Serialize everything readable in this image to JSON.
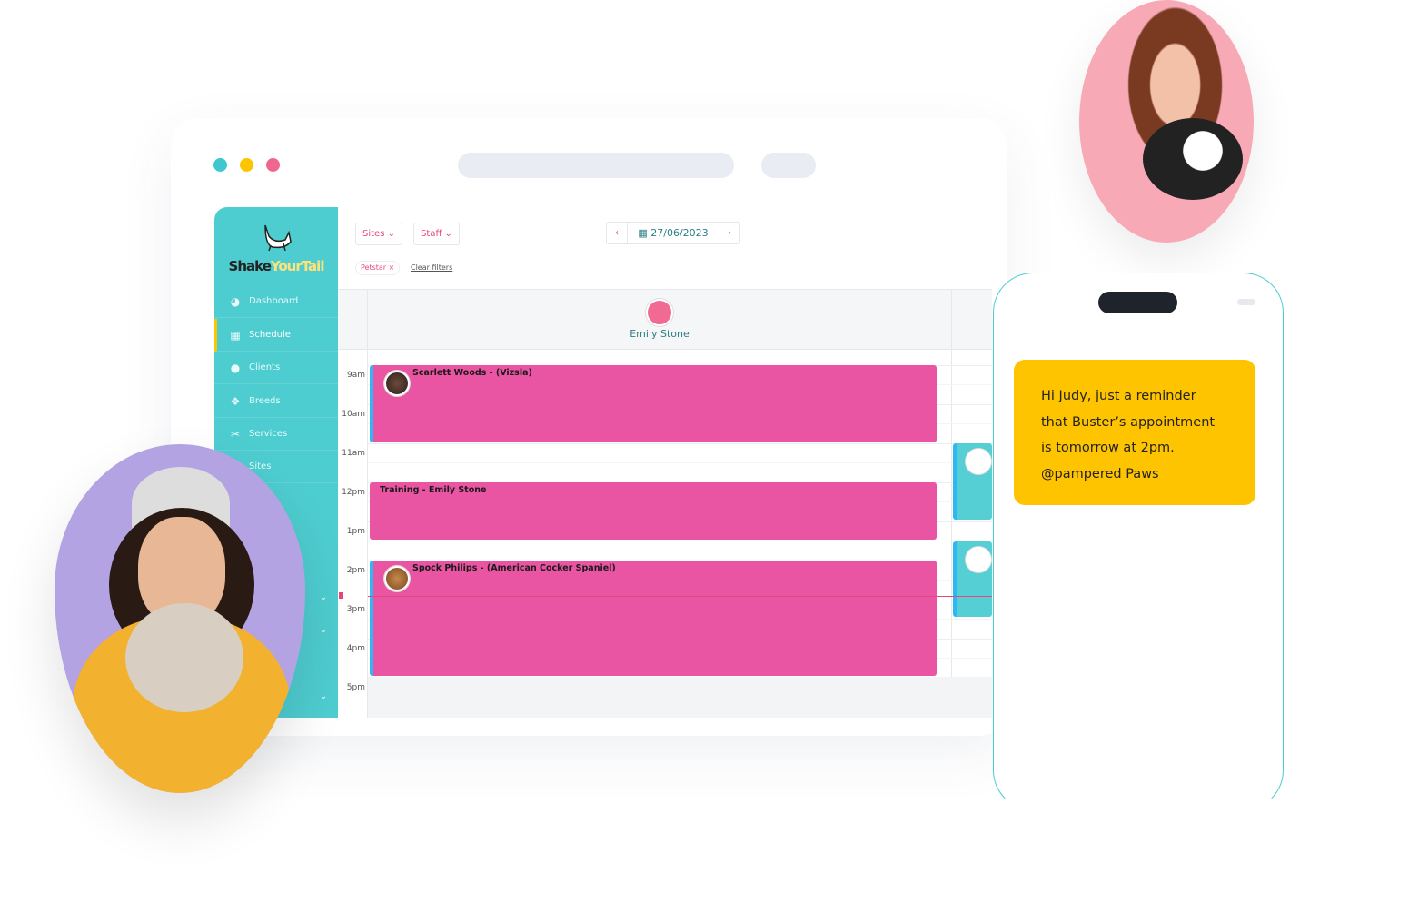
{
  "window": {
    "dots": [
      "#3ec6d1",
      "#ffc400",
      "#f0668f"
    ]
  },
  "brand": {
    "name_dark": "Shake",
    "name_light": "YourTail"
  },
  "sidebar": {
    "items": [
      {
        "label": "Dashboard",
        "icon": "gauge-icon"
      },
      {
        "label": "Schedule",
        "icon": "calendar-icon",
        "active": true
      },
      {
        "label": "Clients",
        "icon": "user-icon"
      },
      {
        "label": "Breeds",
        "icon": "paw-icon"
      },
      {
        "label": "Services",
        "icon": "scissors-icon"
      },
      {
        "label": "Sites",
        "icon": "location-icon"
      }
    ]
  },
  "toolbar": {
    "sites_label": "Sites",
    "staff_label": "Staff",
    "date": "27/06/2023",
    "filter_chip": "Petstar",
    "clear_filters": "Clear filters"
  },
  "calendar": {
    "staff_name": "Emily Stone",
    "times": [
      "9am",
      "10am",
      "11am",
      "12pm",
      "1pm",
      "2pm",
      "3pm",
      "4pm",
      "5pm"
    ],
    "events": [
      {
        "title": "Scarlett Woods - (Vizsla)",
        "start": "9am",
        "end": "11am"
      },
      {
        "title": "Training - Emily Stone",
        "start": "12pm",
        "end": "1:30pm"
      },
      {
        "title": "Spock Philips - (American Cocker Spaniel)",
        "start": "2pm",
        "end": "5pm"
      }
    ],
    "current_time": "2:40pm"
  },
  "phone": {
    "message_lines": [
      "Hi Judy, just a reminder",
      "that Buster’s appointment",
      "is tomorrow at 2pm.",
      "@pampered Paws"
    ]
  },
  "colors": {
    "teal": "#4ecdd0",
    "pink": "#e954a3",
    "yellow": "#ffc400",
    "accent": "#e8467c"
  }
}
